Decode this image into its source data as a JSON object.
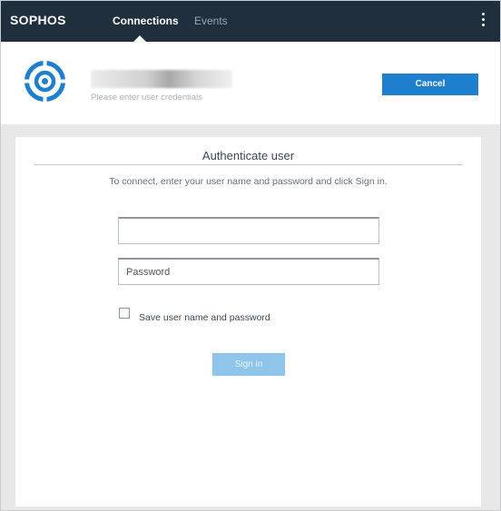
{
  "topbar": {
    "brand": "SOPHOS",
    "tabs": [
      {
        "label": "Connections",
        "active": true
      },
      {
        "label": "Events",
        "active": false
      }
    ]
  },
  "header": {
    "subtitle": "Please enter user credentials",
    "cancel_label": "Cancel"
  },
  "panel": {
    "title": "Authenticate user",
    "instructions": "To connect, enter your user name and password and click Sign in.",
    "username": {
      "value": "",
      "placeholder": ""
    },
    "password": {
      "value": "",
      "placeholder": "Password"
    },
    "save_label": "Save user name and password",
    "save_checked": false,
    "signin_label": "Sign in"
  },
  "colors": {
    "topbar_bg": "#1f2f3e",
    "accent": "#1f7fcf",
    "signin_disabled": "#8fc5ea"
  }
}
